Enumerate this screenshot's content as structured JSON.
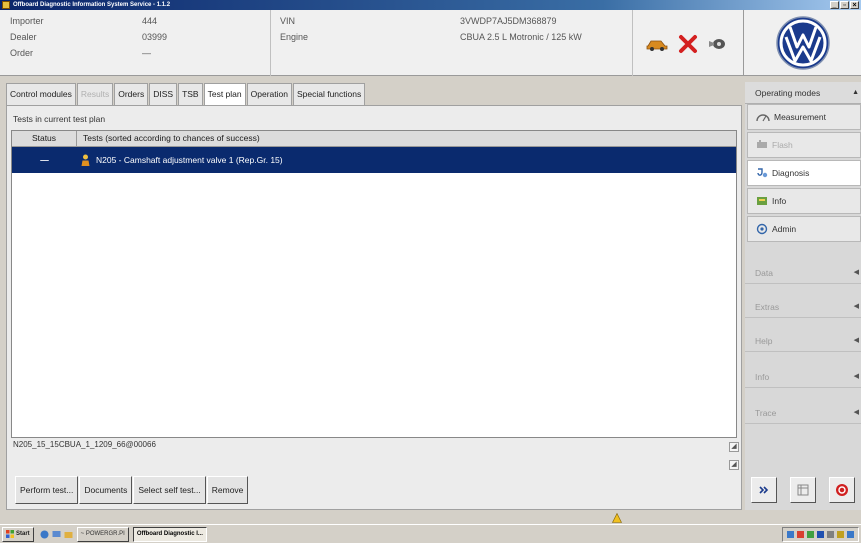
{
  "window": {
    "title": "Offboard Diagnostic Information System Service - 1.1.2"
  },
  "header": {
    "importer_label": "Importer",
    "importer_value": "444",
    "dealer_label": "Dealer",
    "dealer_value": "03999",
    "order_label": "Order",
    "order_value": "—",
    "vin_label": "VIN",
    "vin_value": "3VWDP7AJ5DM368879",
    "engine_label": "Engine",
    "engine_value": "CBUA 2.5 L Motronic / 125 kW"
  },
  "tabs": [
    {
      "label": "Control modules",
      "state": "normal"
    },
    {
      "label": "Results",
      "state": "disabled"
    },
    {
      "label": "Orders",
      "state": "normal"
    },
    {
      "label": "DISS",
      "state": "normal"
    },
    {
      "label": "TSB",
      "state": "normal"
    },
    {
      "label": "Test plan",
      "state": "active"
    },
    {
      "label": "Operation",
      "state": "normal"
    },
    {
      "label": "Special functions",
      "state": "normal"
    }
  ],
  "main": {
    "plan_label": "Tests in current test plan",
    "col_status": "Status",
    "col_tests": "Tests (sorted according to chances of success)",
    "rows": [
      {
        "status": "—",
        "icon": "person-icon",
        "text": "N205 - Camshaft adjustment valve 1 (Rep.Gr. 15)"
      }
    ],
    "filename": "N205_15_15CBUA_1_1209_66@00066"
  },
  "buttons": {
    "perform": "Perform test...",
    "documents": "Documents",
    "select_self": "Select self test...",
    "remove": "Remove"
  },
  "sidebar": {
    "title": "Operating modes",
    "items": [
      {
        "label": "Measurement",
        "icon": "measurement-icon",
        "state": "normal"
      },
      {
        "label": "Flash",
        "icon": "flash-icon",
        "state": "dim"
      },
      {
        "label": "Diagnosis",
        "icon": "diagnosis-icon",
        "state": "active"
      },
      {
        "label": "Info",
        "icon": "info-icon",
        "state": "normal"
      },
      {
        "label": "Admin",
        "icon": "admin-icon",
        "state": "normal"
      }
    ],
    "sections": [
      "Data",
      "Extras",
      "Help",
      "Info",
      "Trace"
    ]
  },
  "taskbar": {
    "start": "Start",
    "item1": "~ POWERGR.PI",
    "item2": "Offboard Diagnostic I..."
  },
  "colors": {
    "selection": "#0a2a6e",
    "titlebar": "#0a246a",
    "vw_blue": "#1a3a8c",
    "stop_red": "#d02020"
  }
}
